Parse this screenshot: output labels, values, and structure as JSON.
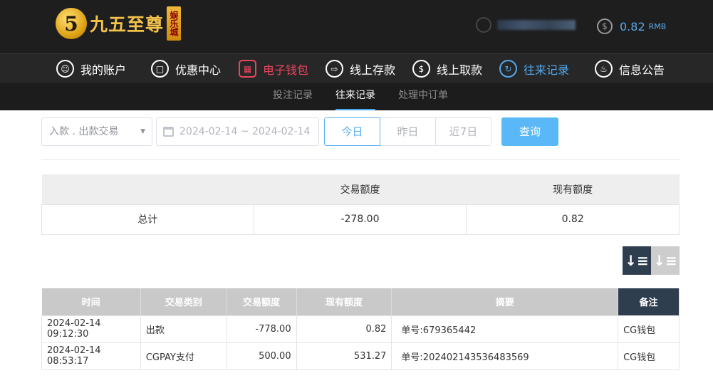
{
  "brand": {
    "logo_mark": "5",
    "name": "九五至尊",
    "tag": "娱乐城"
  },
  "account": {
    "balance": "0.82",
    "currency": "RMB"
  },
  "nav": [
    {
      "label": "我的账户",
      "icon": "user-icon"
    },
    {
      "label": "优惠中心",
      "icon": "gift-icon"
    },
    {
      "label": "电子钱包",
      "icon": "wallet-icon"
    },
    {
      "label": "线上存款",
      "icon": "deposit-icon"
    },
    {
      "label": "线上取款",
      "icon": "withdraw-icon"
    },
    {
      "label": "往来记录",
      "icon": "records-icon"
    },
    {
      "label": "信息公告",
      "icon": "bell-icon"
    }
  ],
  "subnav": [
    {
      "label": "投注记录"
    },
    {
      "label": "往来记录"
    },
    {
      "label": "处理中订单"
    }
  ],
  "filters": {
    "type_value": "入款 . 出款交易",
    "date_range": "2024-02-14 ~ 2024-02-14",
    "quick": [
      "今日",
      "昨日",
      "近7日"
    ],
    "query_label": "查询"
  },
  "summary": {
    "headers": [
      "",
      "交易额度",
      "现有额度"
    ],
    "row": [
      "总计",
      "-278.00",
      "0.82"
    ]
  },
  "records": {
    "headers": [
      "时间",
      "交易类别",
      "交易额度",
      "现有额度",
      "摘要",
      "备注"
    ],
    "rows": [
      [
        "2024-02-14 09:12:30",
        "出款",
        "-778.00",
        "0.82",
        "单号:679365442",
        "CG钱包"
      ],
      [
        "2024-02-14 08:53:17",
        "CGPAY支付",
        "500.00",
        "531.27",
        "单号:20240214353648356​9",
        "CG钱包"
      ]
    ]
  },
  "colors": {
    "accent_blue": "#5aaef3",
    "active_red": "#e9455e",
    "header_dark": "#2f3e4f"
  }
}
